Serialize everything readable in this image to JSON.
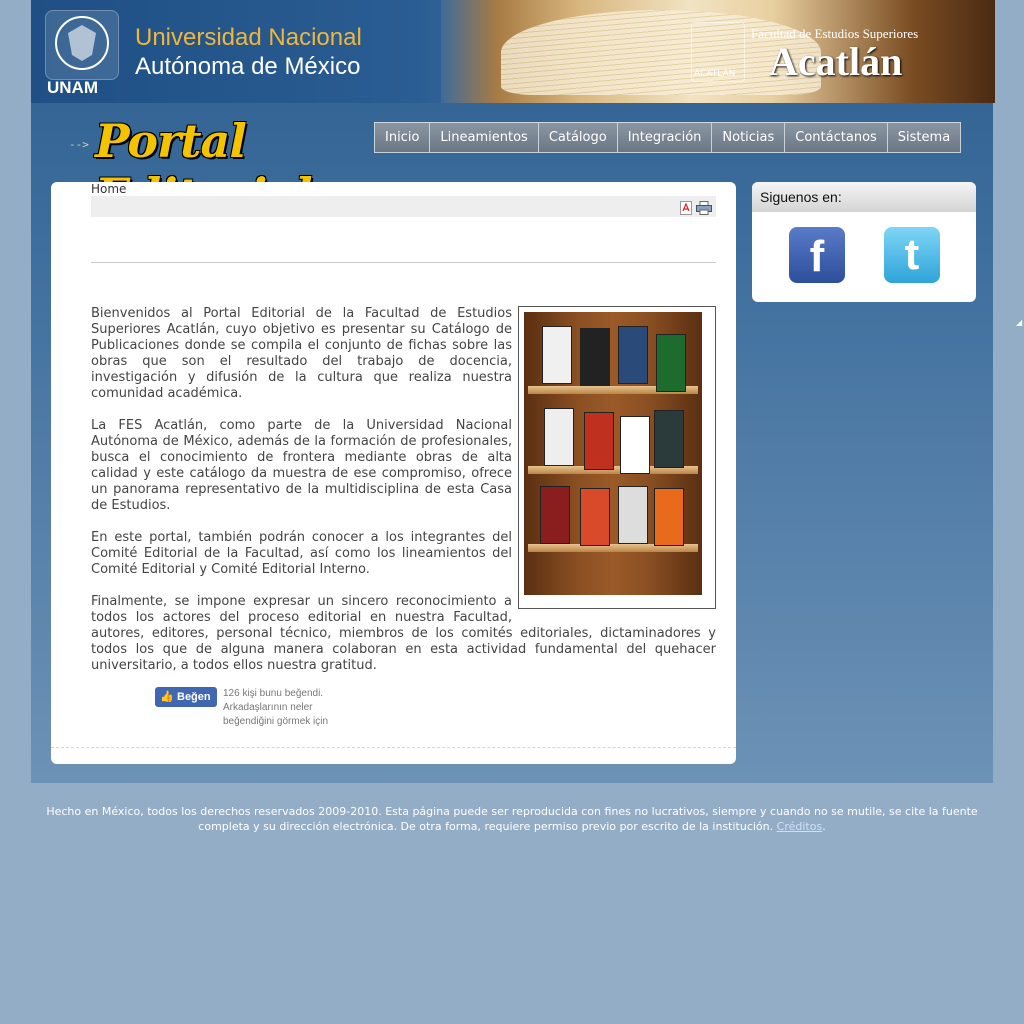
{
  "header": {
    "unam_label": "UNAM",
    "university_line1": "Universidad Nacional",
    "university_line2": "Autónoma de México",
    "fes_subtitle": "Facultad de Estudios Superiores",
    "fes_name": "Acatlán",
    "fes_logo_caption": "ACATLÁN"
  },
  "portal": {
    "arrow": "-->",
    "title": "Portal Editorial"
  },
  "nav": {
    "items": [
      "Inicio",
      "Lineamientos",
      "Catálogo",
      "Integración",
      "Noticias",
      "Contáctanos",
      "Sistema"
    ]
  },
  "content": {
    "breadcrumb": "Home",
    "paragraphs": [
      "Bienvenidos al Portal Editorial de la Facultad de Estudios Superiores Acatlán, cuyo objetivo es presentar su Catálogo de Publicaciones  donde se compila el conjunto de fichas sobre las obras que son el resultado del trabajo de docencia, investigación y difusión de la cultura que realiza nuestra comunidad académica.",
      "La FES Acatlán, como parte de la Universidad Nacional Autónoma de México, además de la formación de profesionales, busca el conocimiento de frontera mediante obras de alta calidad y este catálogo da muestra de ese compromiso, ofrece un panorama representativo de la multidisciplina de esta Casa de Estudios.",
      "En este portal, también podrán conocer a los integrantes del Comité Editorial de la Facultad, así como los lineamientos del Comité Editorial y Comité Editorial Interno.",
      "Finalmente, se impone expresar un sincero reconocimiento a todos los actores del proceso editorial en nuestra Facultad, autores, editores, personal técnico, miembros de los comités editoriales, dictaminadores y todos los que de alguna manera colaboran en esta actividad fundamental del quehacer universitario, a todos ellos nuestra gratitud."
    ],
    "like_button": "Beğen",
    "like_text": "126 kişi bunu beğendi. Arkadaşlarının neler beğendiğini görmek için"
  },
  "side": {
    "header": "Siguenos en:",
    "facebook_glyph": "f",
    "twitter_glyph": "t"
  },
  "footer": {
    "text": "Hecho en México, todos los derechos reservados 2009-2010. Esta página puede ser reproducida con fines no lucrativos, siempre y cuando no se mutile, se cite la fuente completa y su dirección electrónica. De otra forma, requiere permiso previo por escrito de la institución.",
    "credits_link": "Créditos",
    "end": "."
  },
  "colors": {
    "background": "#93adc6",
    "nav": "#7a8693",
    "portal_title": "#f3c300",
    "unam_gold": "#f0b63b"
  },
  "icons": [
    "pdf-icon",
    "print-icon",
    "facebook-icon",
    "twitter-icon",
    "like-thumb-icon"
  ]
}
